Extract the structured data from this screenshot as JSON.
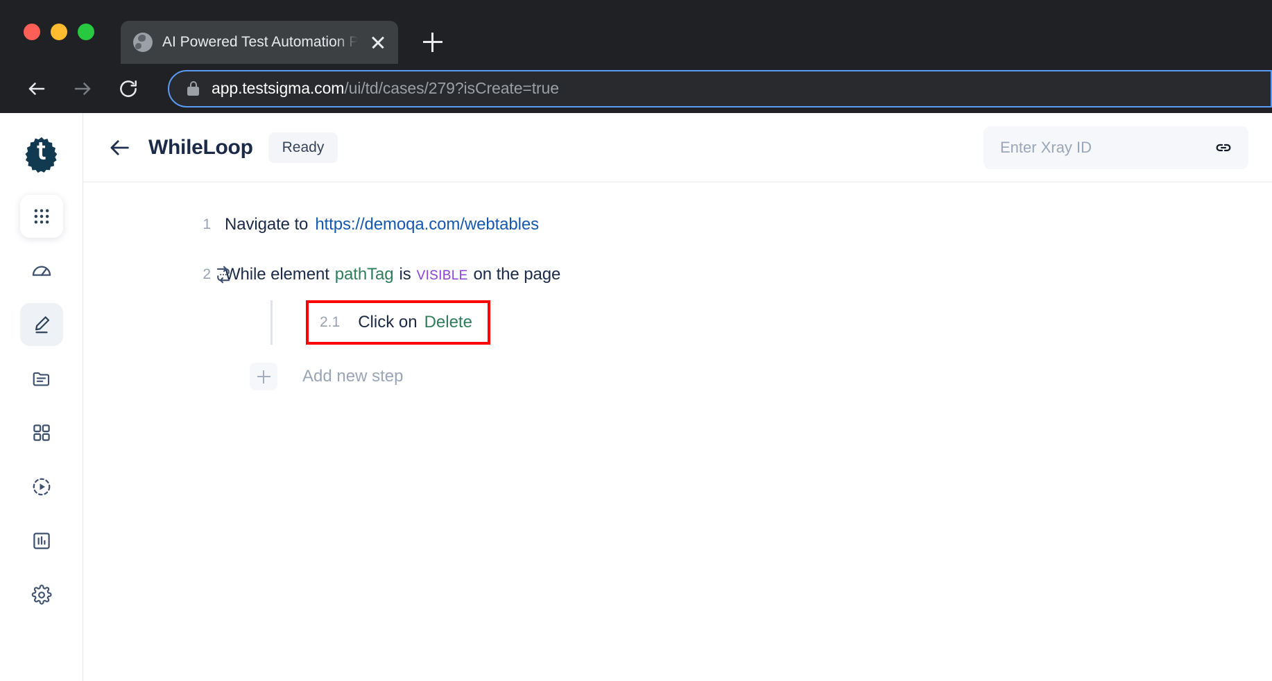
{
  "browser": {
    "tab": {
      "title": "AI Powered Test Automation Pla",
      "favicon_icon": "globe-icon",
      "close_icon": "close-icon"
    },
    "new_tab_icon": "plus-icon",
    "nav": {
      "back_icon": "arrow-left-icon",
      "forward_icon": "arrow-right-icon",
      "reload_icon": "reload-icon"
    },
    "address_bar": {
      "lock_icon": "lock-icon",
      "host": "app.testsigma.com",
      "path": "/ui/td/cases/279?isCreate=true"
    },
    "window_controls": {
      "close": "close-traffic-light",
      "minimize": "minimize-traffic-light",
      "maximize": "maximize-traffic-light"
    }
  },
  "sidebar": {
    "logo_name": "testsigma-logo",
    "items": [
      {
        "name": "apps-grid",
        "icon": "apps-grid-icon",
        "active": false,
        "card": true
      },
      {
        "name": "dashboard",
        "icon": "speedometer-icon",
        "active": false,
        "card": false
      },
      {
        "name": "test-authoring",
        "icon": "pencil-edit-icon",
        "active": true,
        "card": false
      },
      {
        "name": "test-data",
        "icon": "folder-document-icon",
        "active": false,
        "card": false
      },
      {
        "name": "test-suites",
        "icon": "grid-squares-icon",
        "active": false,
        "card": false
      },
      {
        "name": "test-runs",
        "icon": "play-circle-dashed-icon",
        "active": false,
        "card": false
      },
      {
        "name": "reports",
        "icon": "bar-chart-icon",
        "active": false,
        "card": false
      },
      {
        "name": "settings",
        "icon": "gear-icon",
        "active": false,
        "card": false
      }
    ]
  },
  "header": {
    "back_icon": "arrow-left-icon",
    "title": "WhileLoop",
    "status": "Ready",
    "xray": {
      "placeholder": "Enter Xray ID",
      "value": "",
      "link_icon": "link-chain-icon"
    }
  },
  "steps": {
    "step1": {
      "number": "1",
      "action": "Navigate to",
      "url": "https://demoqa.com/webtables"
    },
    "step2": {
      "number": "2",
      "loop_icon": "loop-repeat-icon",
      "prefix": "While element",
      "element": "pathTag",
      "middle": "is",
      "state": "VISIBLE",
      "suffix": "on the page"
    },
    "step2_1": {
      "number": "2.1",
      "action": "Click on",
      "target": "Delete",
      "highlight_color": "#ff0000"
    },
    "add_step": {
      "icon": "plus-icon",
      "label": "Add new step"
    }
  },
  "colors": {
    "element_green": "#2e7d5b",
    "state_purple": "#8b3fd9",
    "link_blue": "#1558b0",
    "text_navy": "#1b2a47",
    "highlight_red": "#ff0000"
  }
}
